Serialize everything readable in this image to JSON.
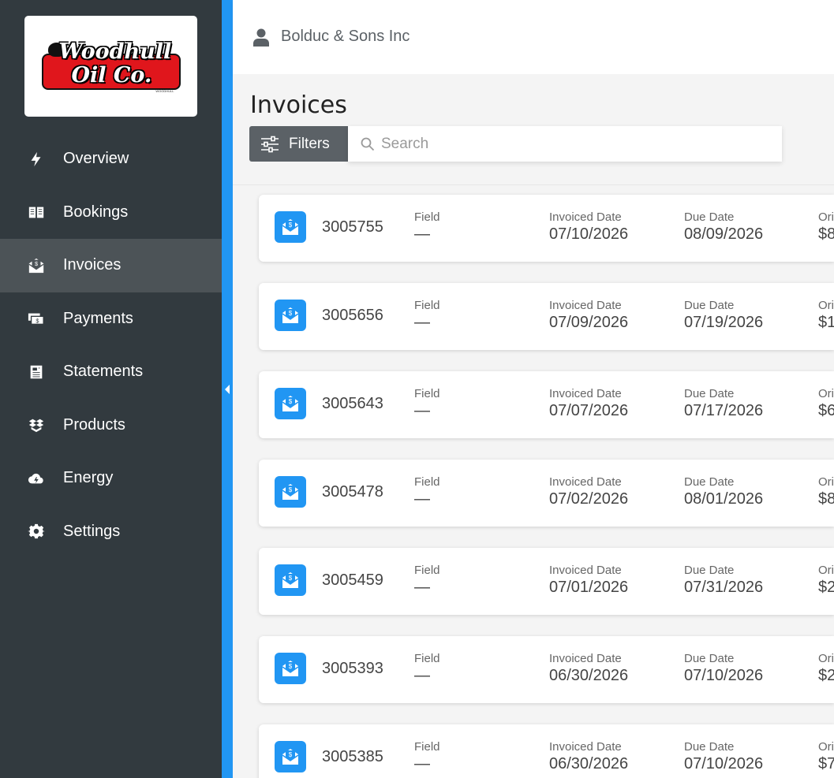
{
  "brand": {
    "logo_line1": "Woodhull",
    "logo_line2": "Oil Co.",
    "logo_small": "WOODHULL"
  },
  "sidebar": {
    "items": [
      {
        "label": "Overview",
        "icon": "bolt-icon"
      },
      {
        "label": "Bookings",
        "icon": "book-icon"
      },
      {
        "label": "Invoices",
        "icon": "invoice-envelope-icon",
        "active": true
      },
      {
        "label": "Payments",
        "icon": "cash-icon"
      },
      {
        "label": "Statements",
        "icon": "document-icon"
      },
      {
        "label": "Products",
        "icon": "boxes-icon"
      },
      {
        "label": "Energy",
        "icon": "cloud-bolt-icon"
      },
      {
        "label": "Settings",
        "icon": "gear-icon"
      }
    ]
  },
  "header": {
    "company": "Bolduc & Sons Inc",
    "user_icon": "user-icon"
  },
  "page": {
    "title": "Invoices",
    "filters_label": "Filters",
    "search_placeholder": "Search"
  },
  "columns": {
    "field": "Field",
    "invoiced_date": "Invoiced Date",
    "due_date": "Due Date",
    "original": "Ori"
  },
  "invoices": [
    {
      "number": "3005755",
      "field": "—",
      "invoiced_date": "07/10/2026",
      "due_date": "08/09/2026",
      "original": "$8"
    },
    {
      "number": "3005656",
      "field": "—",
      "invoiced_date": "07/09/2026",
      "due_date": "07/19/2026",
      "original": "$1"
    },
    {
      "number": "3005643",
      "field": "—",
      "invoiced_date": "07/07/2026",
      "due_date": "07/17/2026",
      "original": "$6"
    },
    {
      "number": "3005478",
      "field": "—",
      "invoiced_date": "07/02/2026",
      "due_date": "08/01/2026",
      "original": "$8"
    },
    {
      "number": "3005459",
      "field": "—",
      "invoiced_date": "07/01/2026",
      "due_date": "07/31/2026",
      "original": "$2"
    },
    {
      "number": "3005393",
      "field": "—",
      "invoiced_date": "06/30/2026",
      "due_date": "07/10/2026",
      "original": "$2"
    },
    {
      "number": "3005385",
      "field": "—",
      "invoiced_date": "06/30/2026",
      "due_date": "07/10/2026",
      "original": "$7"
    }
  ],
  "colors": {
    "sidebar_bg": "#323a3f",
    "active_bg": "#4c5357",
    "accent": "#2196f3",
    "filters_bg": "#5b6166"
  }
}
